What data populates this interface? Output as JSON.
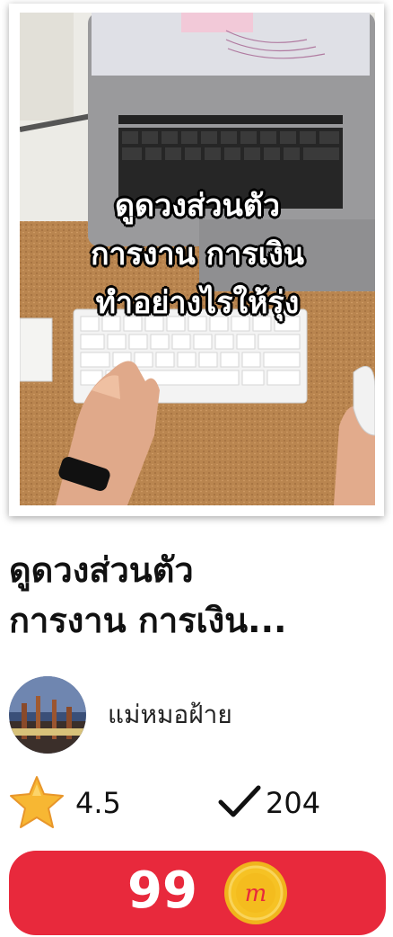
{
  "cover": {
    "lines": [
      "ดูดวงส่วนตัว",
      "การงาน การเงิน",
      "ทำอย่างไรให้รุ่ง"
    ]
  },
  "title": {
    "line1": "ดูดวงส่วนตัว",
    "line2": "การงาน การเงิน..."
  },
  "author": {
    "name": "แม่หมอฝ้าย"
  },
  "stats": {
    "rating": "4.5",
    "count": "204",
    "rating_icon": "star-icon",
    "count_icon": "checkmark-icon"
  },
  "buy": {
    "price": "99",
    "coin_symbol": "m",
    "color": "#e8293c",
    "coin_color": "#f6c224"
  }
}
